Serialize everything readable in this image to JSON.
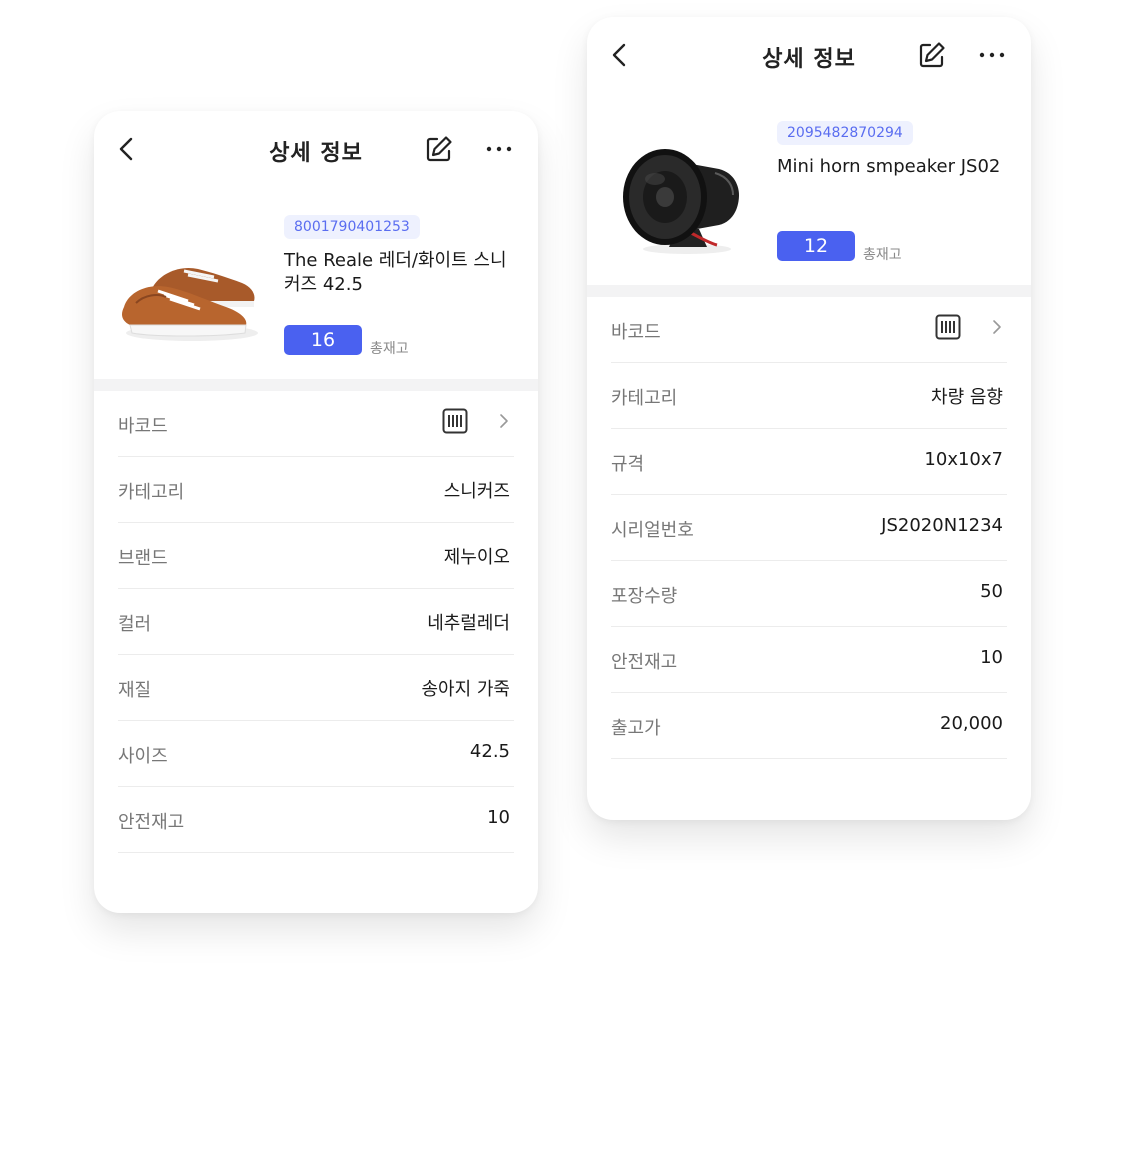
{
  "cards": [
    {
      "header": {
        "title": "상세 정보"
      },
      "product": {
        "barcode": "8001790401253",
        "name": "The Reale 레더/화이트 스니커즈 42.5",
        "qty": "16",
        "qty_label": "총재고",
        "thumb_icon": "sneaker-image"
      },
      "rows": [
        {
          "label": "바코드",
          "value": ""
        },
        {
          "label": "카테고리",
          "value": "스니커즈"
        },
        {
          "label": "브랜드",
          "value": "제누이오"
        },
        {
          "label": "컬러",
          "value": "네추럴레더"
        },
        {
          "label": "재질",
          "value": "송아지 가죽"
        },
        {
          "label": "사이즈",
          "value": "42.5"
        },
        {
          "label": "안전재고",
          "value": "10"
        }
      ]
    },
    {
      "header": {
        "title": "상세 정보"
      },
      "product": {
        "barcode": "2095482870294",
        "name": "Mini horn smpeaker JS02",
        "qty": "12",
        "qty_label": "총재고",
        "thumb_icon": "horn-speaker-image"
      },
      "rows": [
        {
          "label": "바코드",
          "value": ""
        },
        {
          "label": "카테고리",
          "value": "차량 음향"
        },
        {
          "label": "규격",
          "value": "10x10x7"
        },
        {
          "label": "시리얼번호",
          "value": "JS2020N1234"
        },
        {
          "label": "포장수량",
          "value": "50"
        },
        {
          "label": "안전재고",
          "value": "10"
        },
        {
          "label": "출고가",
          "value": "20,000"
        }
      ]
    }
  ],
  "colors": {
    "accent": "#4a61f0",
    "chip_bg": "#eef1fe",
    "chip_text": "#5a6df0",
    "label_gray": "#777777"
  }
}
